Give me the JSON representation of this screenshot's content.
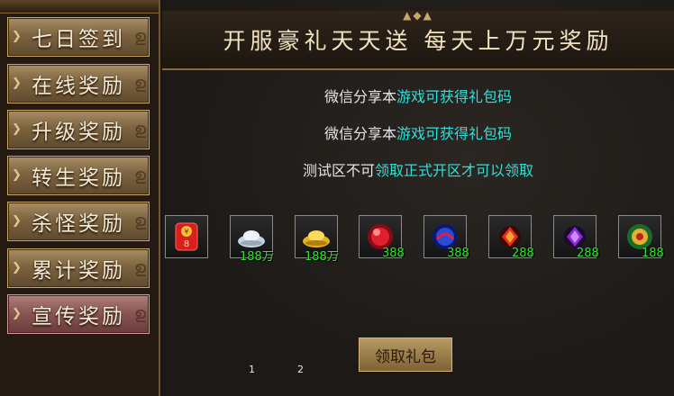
{
  "sidebar": {
    "items": [
      {
        "label": "七日签到",
        "active": false
      },
      {
        "label": "在线奖励",
        "active": false
      },
      {
        "label": "升级奖励",
        "active": false
      },
      {
        "label": "转生奖励",
        "active": false
      },
      {
        "label": "杀怪奖励",
        "active": false
      },
      {
        "label": "累计奖励",
        "active": false
      },
      {
        "label": "宣传奖励",
        "active": true
      }
    ]
  },
  "banner": {
    "title": "开服豪礼天天送 每天上万元奖励"
  },
  "info": {
    "line1_a": "微信分享本",
    "line1_b": "游戏可获得礼包码",
    "line2_a": "微信分享本",
    "line2_b": "游戏可获得礼包码",
    "line3_a": "测试区不可",
    "line3_b": "领取正式开区才可以领取"
  },
  "rewards": [
    {
      "icon": "red-envelope-icon",
      "count": "",
      "badge": "8"
    },
    {
      "icon": "silver-ingot-icon",
      "count": "188万"
    },
    {
      "icon": "gold-ingot-icon",
      "count": "188万"
    },
    {
      "icon": "red-orb-icon",
      "count": "388"
    },
    {
      "icon": "blue-orb-icon",
      "count": "388"
    },
    {
      "icon": "red-gem-icon",
      "count": "288"
    },
    {
      "icon": "purple-gem-icon",
      "count": "288"
    },
    {
      "icon": "jade-disc-icon",
      "count": "188"
    }
  ],
  "claim_button": {
    "label": "领取礼包"
  },
  "pagination": {
    "page1": "1",
    "page2": "2"
  },
  "colors": {
    "highlight": "#2fe0d8",
    "count": "#36e036"
  }
}
